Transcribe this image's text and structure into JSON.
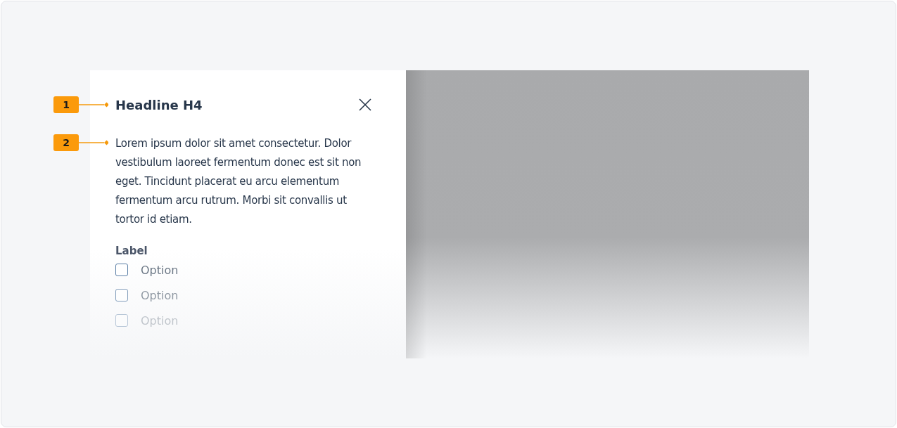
{
  "annotations": [
    {
      "label": "1"
    },
    {
      "label": "2"
    }
  ],
  "panel": {
    "title": "Headline H4",
    "body": "Lorem ipsum dolor sit amet consectetur. Dolor vestibulum laoreet fermentum donec est sit non eget. Tincidunt placerat eu arcu elementum fermentum arcu rutrum. Morbi sit convallis ut tortor id etiam.",
    "group_label": "Label",
    "options": [
      {
        "label": "Option",
        "checked": false
      },
      {
        "label": "Option",
        "checked": false
      },
      {
        "label": "Option",
        "checked": false
      }
    ]
  }
}
